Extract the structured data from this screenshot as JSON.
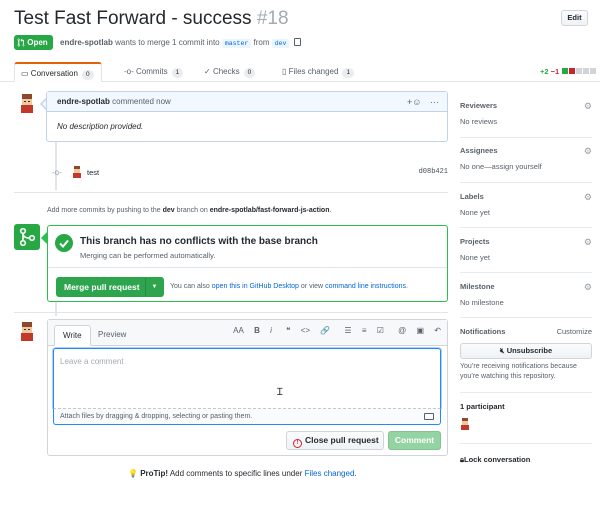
{
  "pr": {
    "title": "Test Fast Forward - success",
    "number": "#18",
    "edit_label": "Edit",
    "state": "Open",
    "author": "endre-spotlab",
    "merge_text": "wants to merge 1 commit into",
    "base_branch": "master",
    "from_text": "from",
    "head_branch": "dev"
  },
  "tabs": [
    {
      "label": "Conversation",
      "count": "0"
    },
    {
      "label": "Commits",
      "count": "1"
    },
    {
      "label": "Checks",
      "count": "0"
    },
    {
      "label": "Files changed",
      "count": "1"
    }
  ],
  "diffstat": {
    "additions": "+2",
    "deletions": "−1"
  },
  "comment": {
    "author": "endre-spotlab",
    "action": "commented now",
    "body": "No description provided."
  },
  "commit": {
    "message": "test",
    "sha": "d08b421"
  },
  "add_more": {
    "prefix": "Add more commits by pushing to the",
    "branch": "dev",
    "middle": "branch on",
    "repo": "endre-spotlab/fast-forward-js-action",
    "suffix": "."
  },
  "merge": {
    "title": "This branch has no conflicts with the base branch",
    "subtitle": "Merging can be performed automatically.",
    "button": "Merge pull request",
    "alt_prefix": "You can also",
    "alt_link1": "open this in GitHub Desktop",
    "alt_middle": "or view",
    "alt_link2": "command line instructions",
    "alt_suffix": "."
  },
  "editor": {
    "tab_write": "Write",
    "tab_preview": "Preview",
    "placeholder": "Leave a comment",
    "attach_text": "Attach files by dragging & dropping, selecting or pasting them.",
    "close_button": "Close pull request",
    "comment_button": "Comment",
    "toolbar": [
      "AA",
      "B",
      "i",
      "❝",
      "<>",
      "🔗",
      "☰",
      "≡",
      "☑",
      "@",
      "▣",
      "↶"
    ]
  },
  "protip": {
    "label": "ProTip!",
    "text": "Add comments to specific lines under",
    "link": "Files changed",
    "suffix": "."
  },
  "sidebar": {
    "reviewers": {
      "heading": "Reviewers",
      "value": "No reviews"
    },
    "assignees": {
      "heading": "Assignees",
      "value": "No one—assign yourself"
    },
    "labels": {
      "heading": "Labels",
      "value": "None yet"
    },
    "projects": {
      "heading": "Projects",
      "value": "None yet"
    },
    "milestone": {
      "heading": "Milestone",
      "value": "No milestone"
    },
    "notifications": {
      "heading": "Notifications",
      "customize": "Customize",
      "button": "Unsubscribe",
      "note": "You’re receiving notifications because you’re watching this repository."
    },
    "participants": {
      "heading": "1 participant"
    },
    "lock": "Lock conversation"
  },
  "colors": {
    "green": "#28a745",
    "red": "#cb2431",
    "link": "#0366d6",
    "tab_accent": "#e36209"
  }
}
